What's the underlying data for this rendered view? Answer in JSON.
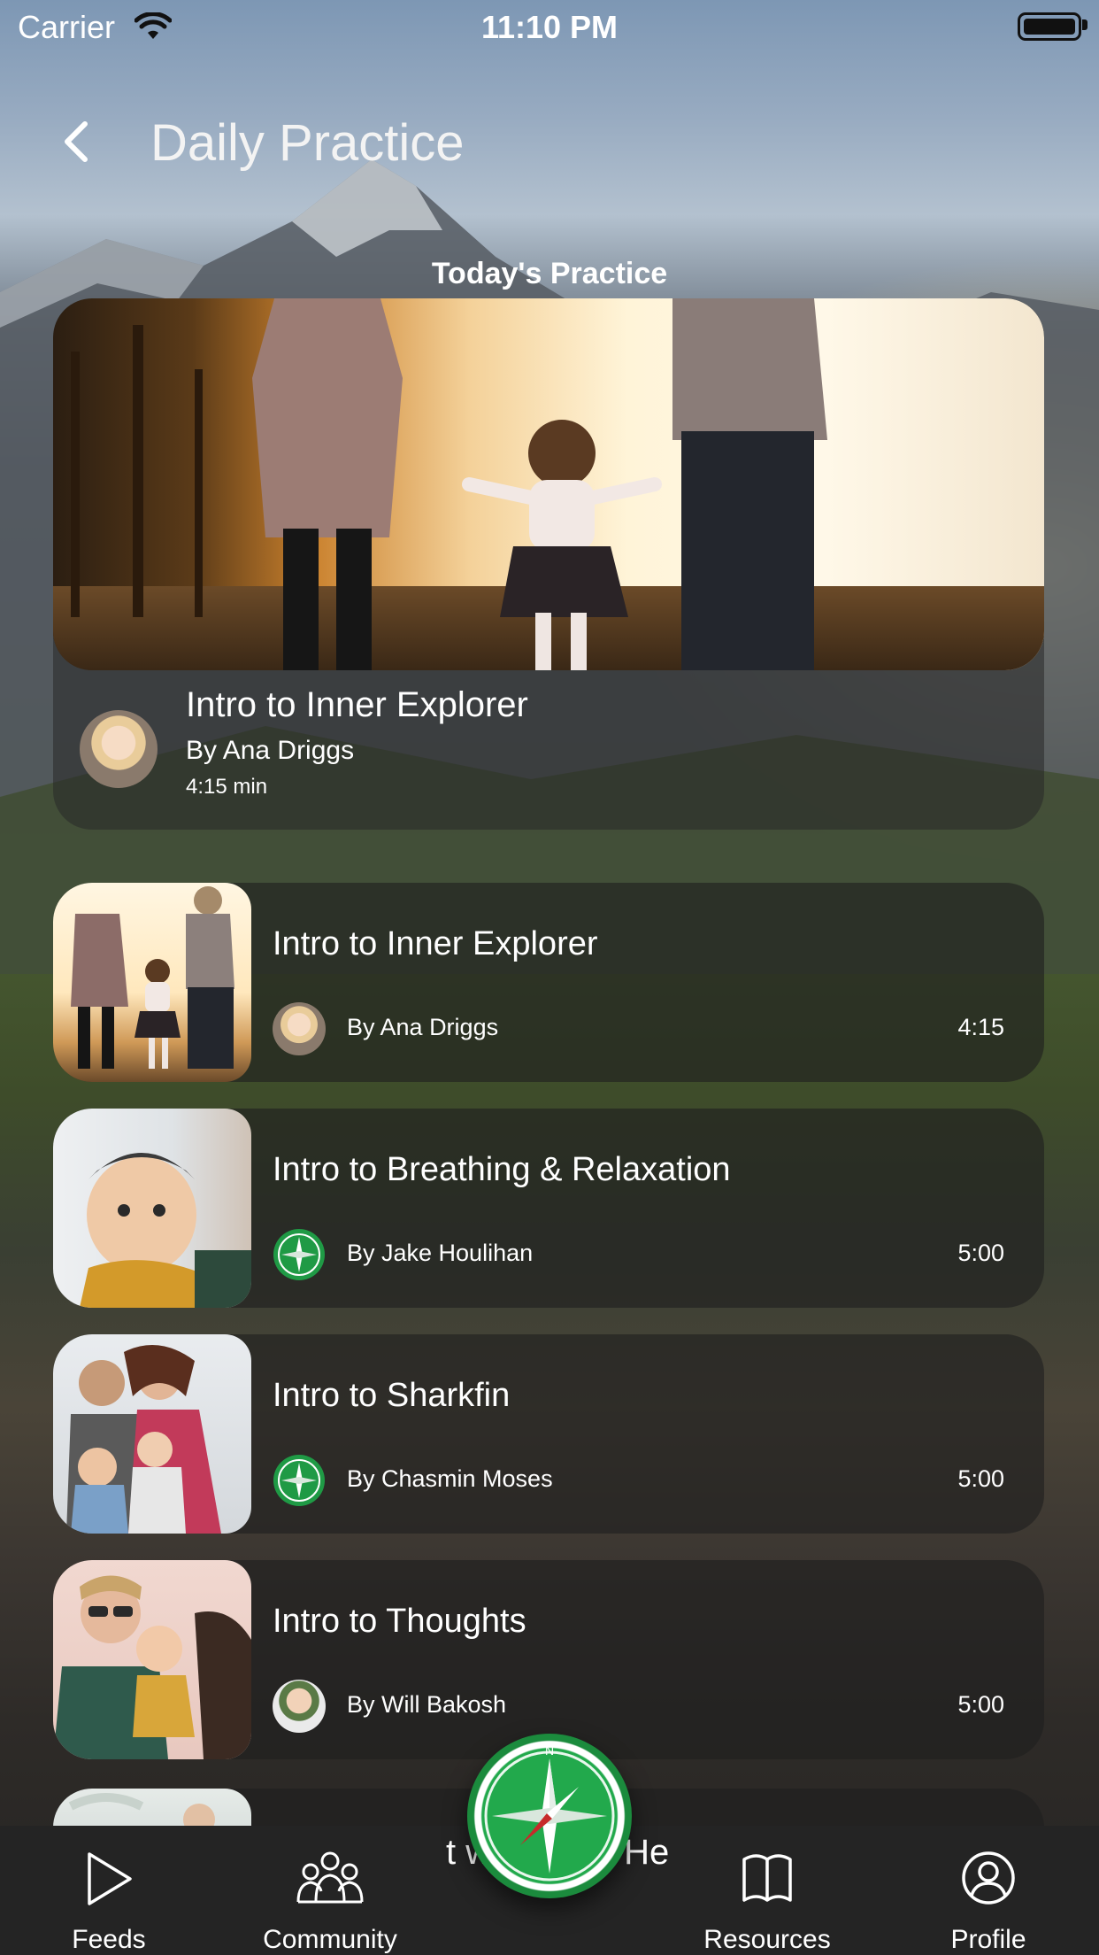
{
  "status_bar": {
    "carrier": "Carrier",
    "time": "11:10 PM"
  },
  "nav": {
    "title": "Daily Practice"
  },
  "section_title": "Today's Practice",
  "featured": {
    "title": "Intro to Inner Explorer",
    "author": "By Ana Driggs",
    "duration": "4:15 min"
  },
  "practices": [
    {
      "title": "Intro to Inner Explorer",
      "author": "By Ana Driggs",
      "duration": "4:15",
      "avatar": "person-avatar"
    },
    {
      "title": "Intro to Breathing & Relaxation",
      "author": "By Jake Houlihan",
      "duration": "5:00",
      "avatar": "compass-icon"
    },
    {
      "title": "Intro to Sharkfin",
      "author": "By Chasmin Moses",
      "duration": "5:00",
      "avatar": "compass-icon"
    },
    {
      "title": "Intro to Thoughts",
      "author": "By Will Bakosh",
      "duration": "5:00",
      "avatar": "person-avatar"
    }
  ],
  "partial_row_text": "t w",
  "partial_row_text_2": "He",
  "tabs": [
    {
      "label": "Feeds",
      "icon": "play-icon"
    },
    {
      "label": "Community",
      "icon": "community-icon"
    },
    {
      "label": "Resources",
      "icon": "book-icon"
    },
    {
      "label": "Profile",
      "icon": "profile-icon"
    }
  ],
  "colors": {
    "accent_green": "#22a94c",
    "tabbar_bg": "#242424"
  }
}
